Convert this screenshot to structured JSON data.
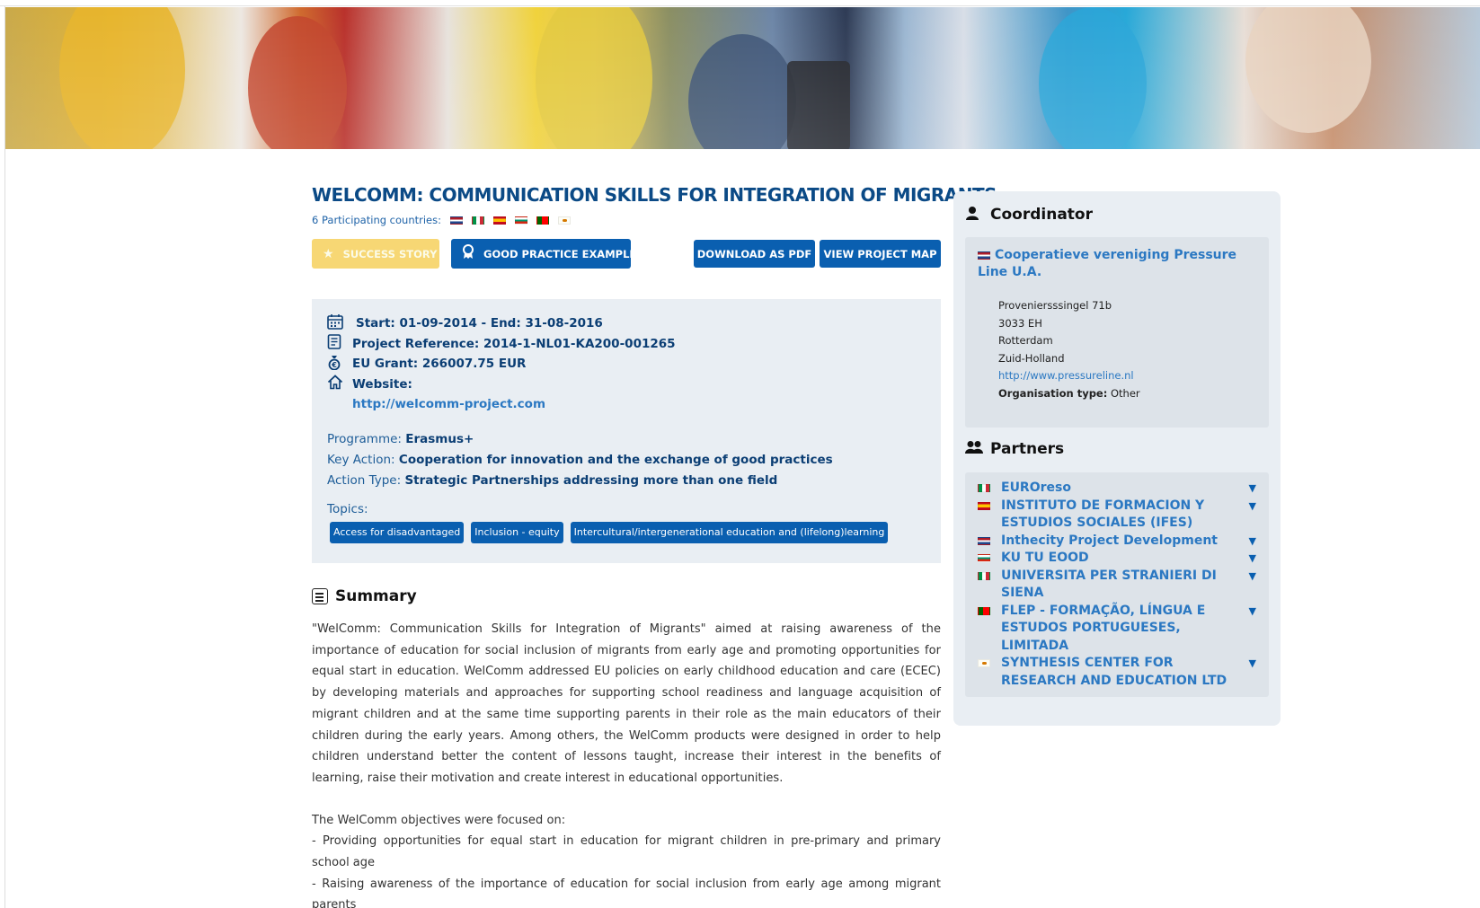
{
  "project": {
    "title": "WELCOMM: COMMUNICATION SKILLS FOR INTEGRATION OF MIGRANTS",
    "participating_label": "6 Participating countries:",
    "participating_flags": [
      "nl",
      "it",
      "es",
      "bg",
      "pt",
      "cy"
    ]
  },
  "buttons": {
    "success_story": "SUCCESS STORY",
    "good_practice": "GOOD PRACTICE EXAMPLE",
    "download_pdf": "DOWNLOAD AS PDF",
    "view_map": "VIEW PROJECT MAP"
  },
  "info": {
    "dates": "Start: 01-09-2014 - End: 31-08-2016",
    "reference": "Project Reference: 2014-1-NL01-KA200-001265",
    "grant": "EU Grant: 266007.75 EUR",
    "website_label": "Website:",
    "website_url": "http://welcomm-project.com",
    "programme_label": "Programme:",
    "programme_value": "Erasmus+",
    "key_action_label": "Key Action:",
    "key_action_value": "Cooperation for innovation and the exchange of good practices",
    "action_type_label": "Action Type:",
    "action_type_value": "Strategic Partnerships addressing more than one field",
    "topics_label": "Topics:",
    "topics": [
      "Access for disadvantaged",
      "Inclusion - equity",
      "Intercultural/intergenerational education and (lifelong)learning"
    ]
  },
  "summary": {
    "heading": "Summary",
    "paragraph1": "\"WelComm: Communication Skills for Integration of Migrants\" aimed at raising awareness of the importance of education for social inclusion of migrants from early age and promoting opportunities for equal start in education. WelComm addressed EU policies on early childhood education and care (ECEC) by developing materials and approaches for supporting school readiness and language acquisition of migrant children and at the same time supporting parents in their role as the main educators of their children during the early years. Among others, the WelComm products were designed in order to help children understand better the content of lessons taught, increase their interest in the benefits of learning, raise their motivation and create interest in educational opportunities.",
    "objectives_intro": "The WelComm objectives were focused on:",
    "objective1": "- Providing opportunities for equal start in education for migrant children in pre-primary and primary school age",
    "objective2": "- Raising awareness of the importance of education for social inclusion from early age among migrant parents"
  },
  "coordinator": {
    "heading": "Coordinator",
    "flag": "nl",
    "name": "Cooperatieve vereniging Pressure Line U.A.",
    "street": "Proveniersssingel 71b",
    "postcode": "3033 EH",
    "city": "Rotterdam",
    "region": "Zuid-Holland",
    "url": "http://www.pressureline.nl",
    "org_type_label": "Organisation type:",
    "org_type_value": "Other"
  },
  "partners": {
    "heading": "Partners",
    "items": [
      {
        "flag": "it",
        "name": "EUROreso"
      },
      {
        "flag": "es",
        "name": "INSTITUTO DE FORMACION Y ESTUDIOS SOCIALES (IFES)"
      },
      {
        "flag": "nl",
        "name": "Inthecity Project Development"
      },
      {
        "flag": "bg",
        "name": "KU TU EOOD"
      },
      {
        "flag": "it",
        "name": "UNIVERSITA PER STRANIERI DI SIENA"
      },
      {
        "flag": "pt",
        "name": "FLEP - FORMAÇÃO, LÍNGUA E ESTUDOS PORTUGUESES, LIMITADA"
      },
      {
        "flag": "cy",
        "name": "SYNTHESIS CENTER FOR RESEARCH AND EDUCATION LTD"
      }
    ],
    "expand_icon": "triangle-down-icon"
  },
  "colors": {
    "primary": "#0a5fb0",
    "title": "#0b4a86",
    "link": "#2b78c2",
    "success": "#f7d774",
    "panel": "#e9eef3"
  }
}
